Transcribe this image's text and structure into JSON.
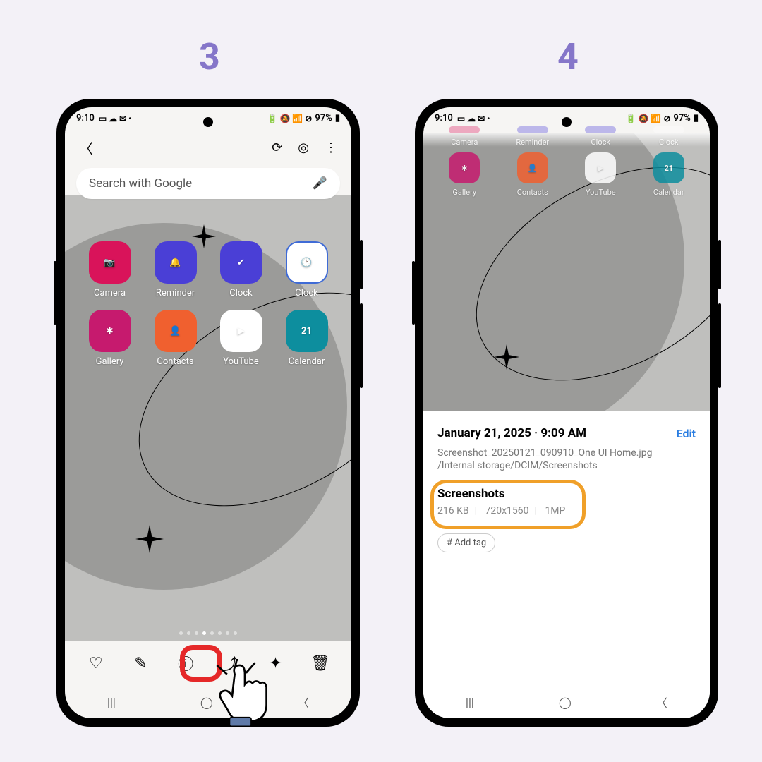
{
  "steps": {
    "s3_label": "3",
    "s4_label": "4"
  },
  "status": {
    "time": "9:10",
    "left_icons": "▭ ☁ ✉ •",
    "right_icons": "🔋 🔕 📶 ⊘",
    "battery": "97%"
  },
  "search": {
    "placeholder": "Search with Google",
    "mic": "🎤"
  },
  "apps_row1": [
    {
      "label": "Camera",
      "bg": "#d9135a",
      "glyph": "📷"
    },
    {
      "label": "Reminder",
      "bg": "#4a3fd6",
      "glyph": "🔔"
    },
    {
      "label": "Clock",
      "bg": "#4a3fd6",
      "glyph": "✔"
    },
    {
      "label": "Clock",
      "bg": "#3f6bd6",
      "glyph": "🕑"
    }
  ],
  "apps_row2": [
    {
      "label": "Gallery",
      "bg": "#c61a6e",
      "glyph": "✱"
    },
    {
      "label": "Contacts",
      "bg": "#f0602f",
      "glyph": "👤"
    },
    {
      "label": "YouTube",
      "bg": "#ffffff",
      "glyph": "▶",
      "fg": "#ff0000"
    },
    {
      "label": "Calendar",
      "bg": "#0d8e9e",
      "glyph": "21"
    }
  ],
  "toolbar3": {
    "fav": "♡",
    "edit": "✎",
    "info": "ⓘ",
    "share": "⤴",
    "ai": "✦",
    "trash": "🗑"
  },
  "details": {
    "date": "January 21, 2025 · 9:09 AM",
    "edit": "Edit",
    "filename": "Screenshot_20250121_090910_One UI Home.jpg",
    "path": "/Internal storage/DCIM/Screenshots",
    "album": "Screenshots",
    "size": "216 KB",
    "dimensions": "720x1560",
    "mp": "1MP",
    "add_tag": "# Add tag"
  }
}
